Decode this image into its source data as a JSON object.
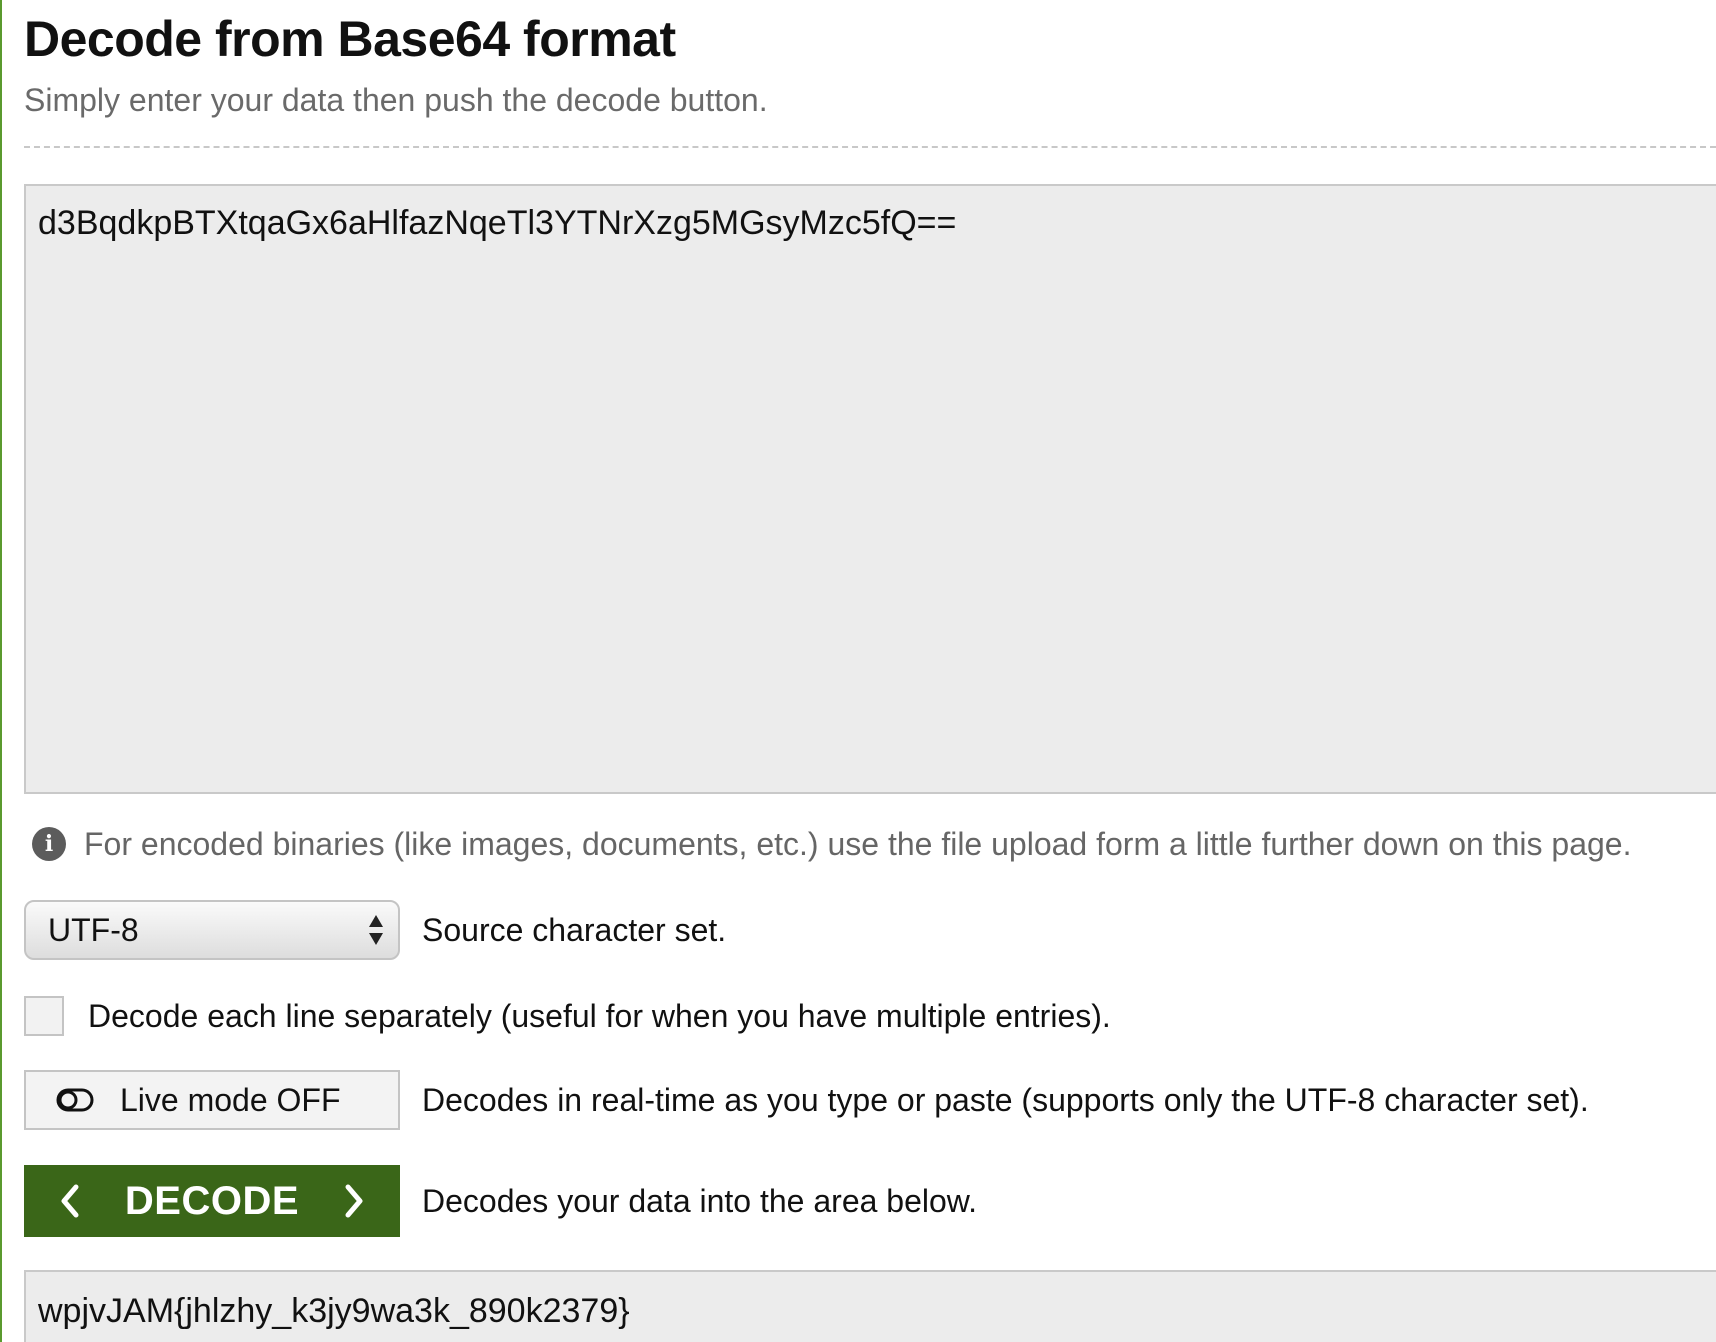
{
  "header": {
    "title": "Decode from Base64 format",
    "subtitle": "Simply enter your data then push the decode button."
  },
  "input": {
    "value": "d3BqdkpBTXtqaGx6aHlfazNqeTl3YTNrXzg5MGsyMzc5fQ=="
  },
  "info": {
    "icon": "info-icon",
    "text": "For encoded binaries (like images, documents, etc.) use the file upload form a little further down on this page."
  },
  "charset": {
    "selected": "UTF-8",
    "description": "Source character set."
  },
  "line_mode": {
    "checked": false,
    "label": "Decode each line separately (useful for when you have multiple entries)."
  },
  "live_mode": {
    "icon": "toggle-off-icon",
    "label": "Live mode OFF",
    "description": "Decodes in real-time as you type or paste (supports only the UTF-8 character set)."
  },
  "decode": {
    "label": "DECODE",
    "description": "Decodes your data into the area below."
  },
  "output": {
    "value": "wpjvJAM{jhlzhy_k3jy9wa3k_890k2379}"
  },
  "colors": {
    "accent_green": "#3a6618",
    "left_rule": "#5a9a2e",
    "textarea_bg": "#ececec"
  }
}
